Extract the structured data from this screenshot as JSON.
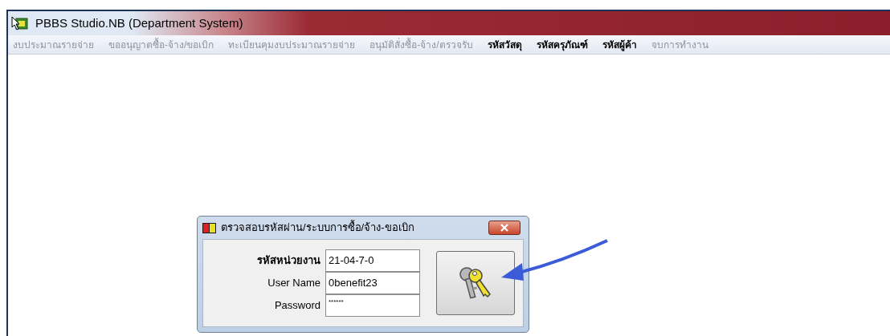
{
  "window": {
    "title": "PBBS Studio.NB (Department System)"
  },
  "menu": [
    {
      "label": "งบประมาณรายจ่าย",
      "disabled": true
    },
    {
      "label": "ขออนุญาตซื้อ-จ้าง/ขอเบิก",
      "disabled": true
    },
    {
      "label": "ทะเบียนคุมงบประมาณรายจ่าย",
      "disabled": true
    },
    {
      "label": "อนุมัติสั่งซื้อ-จ้าง/ตรวจรับ",
      "disabled": true
    },
    {
      "label": "รหัสวัสดุ",
      "disabled": false
    },
    {
      "label": "รหัสครุภัณฑ์",
      "disabled": false
    },
    {
      "label": "รหัสผู้ค้า",
      "disabled": false
    },
    {
      "label": "จบการทำงาน",
      "disabled": true
    }
  ],
  "dialog": {
    "title": "ตรวจสอบรหัสผ่าน/ระบบการซื้อ/จ้าง-ขอเบิก",
    "fields": [
      {
        "label": "รหัสหน่วยงาน",
        "value": "21-04-7-0"
      },
      {
        "label": "User Name",
        "value": "0benefit23"
      },
      {
        "label": "Password",
        "value": "******"
      }
    ]
  }
}
